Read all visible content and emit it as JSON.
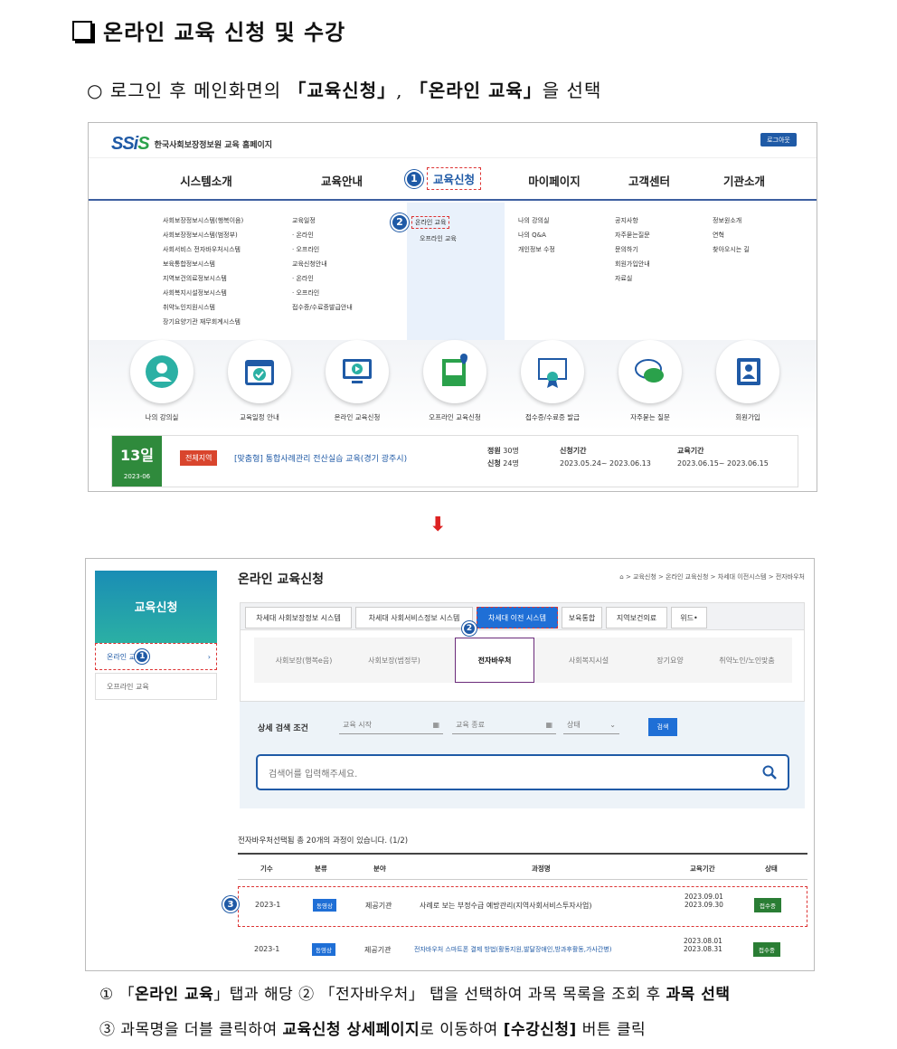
{
  "doc": {
    "title": "온라인 교육 신청 및 수강",
    "instruction_prefix": "로그인 후 메인화면의 ",
    "instruction_a": "「교육신청」",
    "instruction_comma": ", ",
    "instruction_b": "「온라인 교육」",
    "instruction_suffix": "을 선택",
    "caption1_a": "① 「",
    "caption1_b": "온라인 교육",
    "caption1_c": "」탭과 해당 ② 「전자바우처」 탭을 선택하여 과목 목록을 조회 후 ",
    "caption1_d": "과목 선택",
    "caption2_a": "③ 과목명을 더블 클릭하여 ",
    "caption2_b": "교육신청 상세페이지",
    "caption2_c": "로 이동하여 ",
    "caption2_d": "[수강신청]",
    "caption2_e": " 버튼 클릭"
  },
  "shot1": {
    "logo": "SSiS",
    "site_title": "한국사회보장정보원 교육 홈페이지",
    "logout": "로그아웃",
    "nav": [
      "시스템소개",
      "교육안내",
      "교육신청",
      "마이페이지",
      "고객센터",
      "기관소개"
    ],
    "menu_sys": [
      "사회보장정보시스템(행복이음)",
      "사회보장정보시스템(범정부)",
      "사회서비스 전자바우처시스템",
      "보육통합정보시스템",
      "지역보건의료정보시스템",
      "사회복지시설정보시스템",
      "취약노인지원시스템",
      "장기요양기관 재무회계시스템"
    ],
    "menu_guide": [
      "교육일정",
      "· 온라인",
      "· 오프라인",
      "교육신청안내",
      "· 온라인",
      "· 오프라인",
      "접수증/수료증발급안내"
    ],
    "menu_apply": [
      "온라인 교육",
      "오프라인 교육"
    ],
    "menu_my": [
      "나의 강의실",
      "나의 Q&A",
      "개인정보 수정"
    ],
    "menu_cs": [
      "공지사항",
      "자주묻는질문",
      "문의하기",
      "회원가입안내",
      "자료실"
    ],
    "menu_org": [
      "정보원소개",
      "연혁",
      "찾아오시는 길"
    ],
    "quick": [
      "나의 강의실",
      "교육일정 안내",
      "온라인 교육신청",
      "오프라인 교육신청",
      "접수증/수료증 발급",
      "자주묻는 질문",
      "회원가입"
    ],
    "card": {
      "day": "13일",
      "month": "2023-06",
      "region": "전체지역",
      "title": "[맞춤형] 통합사례관리 전산실습 교육(경기 광주시)",
      "cap_label": "정원",
      "cap": "30명",
      "apply_label": "신청",
      "applied": "24명",
      "period_label": "신청기간",
      "period": "2023.05.24~ 2023.06.13",
      "edu_label": "교육기간",
      "edu": "2023.06.15~ 2023.06.15"
    },
    "badge1": "1",
    "badge2": "2"
  },
  "shot2": {
    "side_title": "교육신청",
    "side_items": [
      "온라인 교육",
      "오프라인 교육"
    ],
    "page_title": "온라인 교육신청",
    "breadcrumb": "⌂ > 교육신청 > 온라인 교육신청 > 차세대 이전시스템 > 전자바우처",
    "tabs": [
      "차세대 사회보장정보 시스템",
      "차세대 사회서비스정보 시스템",
      "차세대 이전 시스템",
      "보육통합",
      "지역보건의료",
      "위드•"
    ],
    "subtabs": [
      "사회보장(행복e음)",
      "사회보장(범정부)",
      "전자바우처",
      "사회복지시설",
      "장기요양",
      "취약노인/노인맞춤"
    ],
    "search_label": "상세 검색 조건",
    "start_ph": "교육 시작",
    "end_ph": "교육 종료",
    "status_ph": "상태",
    "search_btn": "검색",
    "search_ph": "검색어를 입력해주세요.",
    "count_text": "전자바우처선택됨 총 20개의 과정이 있습니다. (1/2)",
    "headers": [
      "기수",
      "분류",
      "분야",
      "과정명",
      "교육기간",
      "상태"
    ],
    "rows": [
      {
        "term": "2023-1",
        "type": "동영상",
        "field": "제공기관",
        "name": "사례로 보는 부정수급 예방관리(지역사회서비스투자사업)",
        "d1": "2023.09.01",
        "d2": "2023.09.30",
        "status": "접수중"
      },
      {
        "term": "2023-1",
        "type": "동영상",
        "field": "제공기관",
        "name": "전자바우처 스마트폰 결제 방법(활동지원,발달장애인,방과후활동,가사간병)",
        "d1": "2023.08.01",
        "d2": "2023.08.31",
        "status": "접수중"
      }
    ],
    "badge1": "1",
    "badge2": "2",
    "badge3": "3"
  },
  "colors": {
    "brand": "#1f5aa6",
    "accent": "#d33333",
    "status": "#2a7d34"
  }
}
